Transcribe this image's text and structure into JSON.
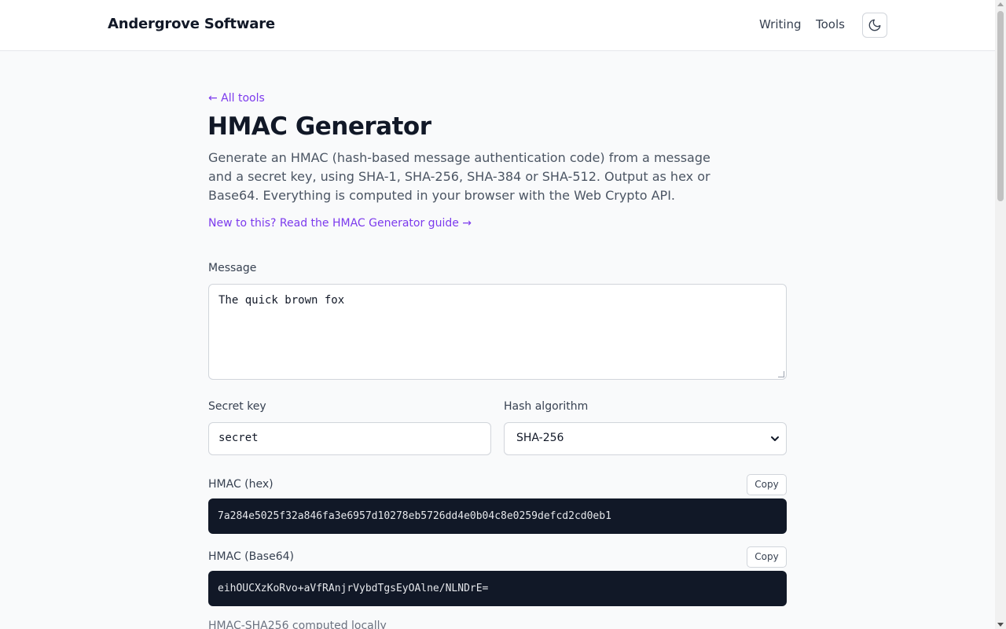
{
  "header": {
    "brand": "Andergrove Software",
    "nav": [
      "Writing",
      "Tools"
    ],
    "theme_icon": "moon-icon"
  },
  "page": {
    "back_link": "← All tools",
    "title": "HMAC Generator",
    "description": "Generate an HMAC (hash-based message authentication code) from a message and a secret key, using SHA-1, SHA-256, SHA-384 or SHA-512. Output as hex or Base64. Everything is computed in your browser with the Web Crypto API.",
    "guide_link": "New to this? Read the HMAC Generator guide →"
  },
  "form": {
    "message_label": "Message",
    "message_value": "The quick brown fox",
    "secret_label": "Secret key",
    "secret_value": "secret",
    "algorithm_label": "Hash algorithm",
    "algorithm_value": "SHA-256"
  },
  "outputs": {
    "hex_label": "HMAC (hex)",
    "hex_value": "7a284e5025f32a846fa3e6957d10278eb5726dd4e0b04c8e0259defcd2cd0eb1",
    "base64_label": "HMAC (Base64)",
    "base64_value": "eihOUCXzKoRvo+aVfRAnjrVybdTgsEyOAlne/NLNDrE=",
    "copy_label": "Copy",
    "footnote": "HMAC-SHA256 computed locally"
  },
  "colors": {
    "accent": "#7c3aed",
    "output_bg": "#111827"
  }
}
